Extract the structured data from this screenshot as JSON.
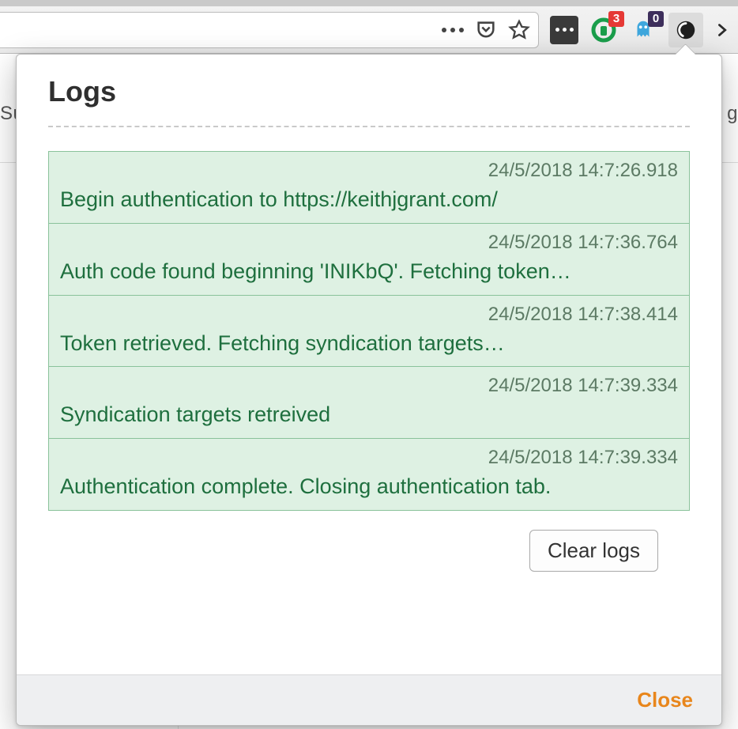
{
  "background": {
    "tab_fragment_left": "Su",
    "tab_fragment_right": "g"
  },
  "toolbar": {
    "icons": {
      "kebab": "page-actions-icon",
      "pocket": "pocket-icon",
      "star": "bookmark-star-icon",
      "lastpass": "lastpass-icon",
      "ublock": "ublock-icon",
      "ghostery": "ghostery-icon",
      "omnibear": "omnibear-icon",
      "overflow": "overflow-chevron-icon"
    },
    "badges": {
      "ublock": "3",
      "ghostery": "0"
    }
  },
  "popup": {
    "title": "Logs",
    "clear_button": "Clear logs",
    "close_link": "Close",
    "logs": [
      {
        "ts": "24/5/2018 14:7:26.918",
        "msg": "Begin authentication to https://keithjgrant.com/"
      },
      {
        "ts": "24/5/2018 14:7:36.764",
        "msg": "Auth code found beginning 'INIKbQ'. Fetching token…"
      },
      {
        "ts": "24/5/2018 14:7:38.414",
        "msg": "Token retrieved. Fetching syndication targets…"
      },
      {
        "ts": "24/5/2018 14:7:39.334",
        "msg": "Syndication targets retreived"
      },
      {
        "ts": "24/5/2018 14:7:39.334",
        "msg": "Authentication complete. Closing authentication tab."
      }
    ]
  },
  "colors": {
    "log_bg": "#def1e3",
    "log_border": "#8ac29b",
    "log_text": "#1e6f3e",
    "close_link": "#e8861c"
  }
}
